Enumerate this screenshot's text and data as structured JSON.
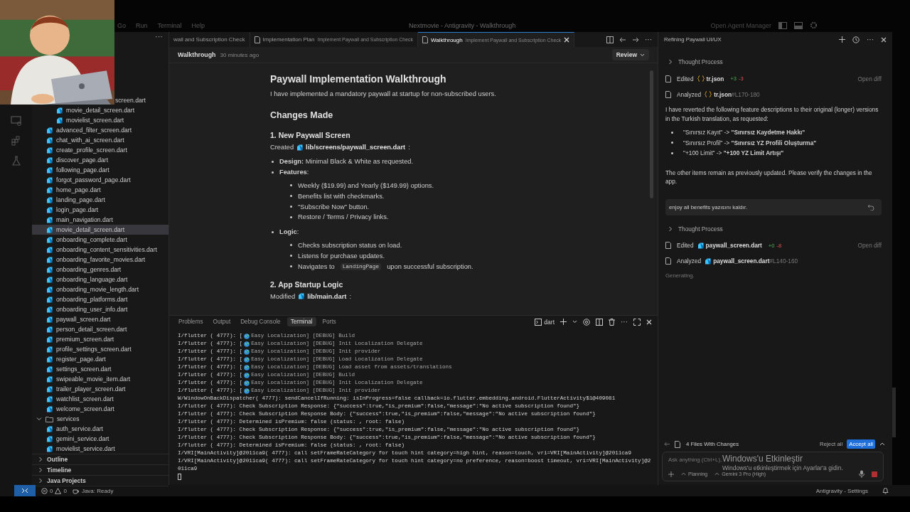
{
  "titlebar": {
    "menu": [
      "Go",
      "Run",
      "Terminal",
      "Help"
    ],
    "title": "Nextmovie - Antigravity - Walkthrough",
    "agent_manager": "Open Agent Manager"
  },
  "explorer": {
    "tree": [
      {
        "children": [
          {
            "children": [
              {
                "kind": "clipped",
                "name": "screen.dart",
                "selected": false
              },
              {
                "kind": "file",
                "name": "movie_detail_screen.dart",
                "selected": false
              },
              {
                "kind": "file",
                "name": "movielist_screen.dart",
                "selected": false
              }
            ]
          },
          {
            "kind": "file",
            "name": "advanced_filter_screen.dart",
            "selected": false
          },
          {
            "kind": "file",
            "name": "chat_with_ai_screen.dart",
            "selected": false
          },
          {
            "kind": "file",
            "name": "create_profile_screen.dart",
            "selected": false
          },
          {
            "kind": "file",
            "name": "discover_page.dart",
            "selected": false
          },
          {
            "kind": "file",
            "name": "following_page.dart",
            "selected": false
          },
          {
            "kind": "file",
            "name": "forgot_password_page.dart",
            "selected": false
          },
          {
            "kind": "file",
            "name": "home_page.dart",
            "selected": false
          },
          {
            "kind": "file",
            "name": "landing_page.dart",
            "selected": false
          },
          {
            "kind": "file",
            "name": "login_page.dart",
            "selected": false
          },
          {
            "kind": "file",
            "name": "main_navigation.dart",
            "selected": false
          },
          {
            "kind": "file",
            "name": "movie_detail_screen.dart",
            "selected": true
          },
          {
            "kind": "file",
            "name": "onboarding_complete.dart",
            "selected": false
          },
          {
            "kind": "file",
            "name": "onboarding_content_sensitivities.dart",
            "selected": false
          },
          {
            "kind": "file",
            "name": "onboarding_favorite_movies.dart",
            "selected": false
          },
          {
            "kind": "file",
            "name": "onboarding_genres.dart",
            "selected": false
          },
          {
            "kind": "file",
            "name": "onboarding_language.dart",
            "selected": false
          },
          {
            "kind": "file",
            "name": "onboarding_movie_length.dart",
            "selected": false
          },
          {
            "kind": "file",
            "name": "onboarding_platforms.dart",
            "selected": false
          },
          {
            "kind": "file",
            "name": "onboarding_user_info.dart",
            "selected": false
          },
          {
            "kind": "file",
            "name": "paywall_screen.dart",
            "selected": false
          },
          {
            "kind": "file",
            "name": "person_detail_screen.dart",
            "selected": false
          },
          {
            "kind": "file",
            "name": "premium_screen.dart",
            "selected": false
          },
          {
            "kind": "file",
            "name": "profile_settings_screen.dart",
            "selected": false
          },
          {
            "kind": "file",
            "name": "register_page.dart",
            "selected": false
          },
          {
            "kind": "file",
            "name": "settings_screen.dart",
            "selected": false
          },
          {
            "kind": "file",
            "name": "swipeable_movie_item.dart",
            "selected": false
          },
          {
            "kind": "file",
            "name": "trailer_player_screen.dart",
            "selected": false
          },
          {
            "kind": "file",
            "name": "watchlist_screen.dart",
            "selected": false
          },
          {
            "kind": "file",
            "name": "welcome_screen.dart",
            "selected": false
          }
        ]
      },
      {
        "kind": "folder",
        "name": "services",
        "expanded": true,
        "children": [
          {
            "kind": "file",
            "name": "auth_service.dart",
            "selected": false
          },
          {
            "kind": "file",
            "name": "gemini_service.dart",
            "selected": false
          },
          {
            "kind": "file",
            "name": "movielist_service.dart",
            "selected": false
          }
        ]
      }
    ],
    "more": "···",
    "sections": [
      {
        "label": "Outline",
        "expanded": false
      },
      {
        "label": "Timeline",
        "expanded": false
      },
      {
        "label": "Java Projects",
        "expanded": false
      }
    ]
  },
  "editor": {
    "tabs": [
      {
        "label": "wall and Subscription Check",
        "selected": false
      },
      {
        "label": "Implementation Plan",
        "description": "Implement Paywall and Subscription Check",
        "selected": false
      },
      {
        "label": "Walkthrough",
        "description": "Implement Paywall and Subscription Check",
        "selected": true
      }
    ],
    "more": "···",
    "breadcrumb": {
      "title": "Walkthrough",
      "time": "30 minutes ago",
      "review": "Review"
    },
    "doc": {
      "title": "Paywall Implementation Walkthrough",
      "intro": "I have implemented a mandatory paywall at startup for non-subscribed users.",
      "blocks": [
        {
          "kind": "h2",
          "text": "Changes Made"
        },
        {
          "kind": "h3",
          "text": "1. New Paywall Screen"
        },
        {
          "kind": "fileref",
          "label": "Created",
          "path": "lib/screens/paywall_screen.dart",
          "after": ":"
        },
        {
          "kind": "list",
          "items": [
            {
              "text": "**Design:** Minimal Black & White as requested."
            },
            {
              "text": "**Features**:",
              "children": [
                {
                  "text": "Weekly ($19.99) and Yearly ($149.99) options."
                },
                {
                  "text": "Benefits list with checkmarks."
                },
                {
                  "text": "\"Subscribe Now\" button."
                },
                {
                  "text": "Restore / Terms / Privacy links."
                }
              ]
            },
            {
              "text": "**Logic**:",
              "children": [
                {
                  "text": "Checks subscription status on load."
                },
                {
                  "text": "Listens for purchase updates."
                },
                {
                  "text": "Navigates to",
                  "code": "LandingPage",
                  "after": "upon successful subscription."
                }
              ]
            }
          ]
        },
        {
          "kind": "h3",
          "text": "2. App Startup Logic"
        },
        {
          "kind": "fileref",
          "label": "Modified",
          "path": "lib/main.dart",
          "after": ":"
        }
      ]
    }
  },
  "panel": {
    "tabs": [
      {
        "label": "Problems",
        "selected": false
      },
      {
        "label": "Output",
        "selected": false
      },
      {
        "label": "Debug Console",
        "selected": false
      },
      {
        "label": "Terminal",
        "selected": true
      },
      {
        "label": "Ports",
        "selected": false
      }
    ],
    "shell": "dart",
    "more": "···",
    "lines": [
      {
        "kind": "easy",
        "prefix": "I/flutter ( 4777): [",
        "text": "Easy Localization] [DEBUG] Build"
      },
      {
        "kind": "easy",
        "prefix": "I/flutter ( 4777): [",
        "text": "Easy Localization] [DEBUG] Init Localization Delegate"
      },
      {
        "kind": "easy",
        "prefix": "I/flutter ( 4777): [",
        "text": "Easy Localization] [DEBUG] Init provider"
      },
      {
        "kind": "easy",
        "prefix": "I/flutter ( 4777): [",
        "text": "Easy Localization] [DEBUG] Load Localization Delegate"
      },
      {
        "kind": "easy",
        "prefix": "I/flutter ( 4777): [",
        "text": "Easy Localization] [DEBUG] Load asset from assets/translations"
      },
      {
        "kind": "easy",
        "prefix": "I/flutter ( 4777): [",
        "text": "Easy Localization] [DEBUG] Build"
      },
      {
        "kind": "easy",
        "prefix": "I/flutter ( 4777): [",
        "text": "Easy Localization] [DEBUG] Init Localization Delegate"
      },
      {
        "kind": "easy",
        "prefix": "I/flutter ( 4777): [",
        "text": "Easy Localization] [DEBUG] Init provider"
      },
      {
        "kind": "plain",
        "text": "W/WindowOnBackDispatcher( 4777): sendCancelIfRunning: isInProgress=false callback=io.flutter.embedding.android.FlutterActivity$1@409081"
      },
      {
        "kind": "plain",
        "text": "I/flutter ( 4777): Check Subscription Response: {\"success\":true,\"is_premium\":false,\"message\":\"No active subscription found\"}"
      },
      {
        "kind": "plain",
        "text": "I/flutter ( 4777): Check Subscription Response Body: {\"success\":true,\"is_premium\":false,\"message\":\"No active subscription found\"}"
      },
      {
        "kind": "plain",
        "text": "I/flutter ( 4777): Determined isPremium: false (status: , root: false)"
      },
      {
        "kind": "plain",
        "text": "I/flutter ( 4777): Check Subscription Response: {\"success\":true,\"is_premium\":false,\"message\":\"No active subscription found\"}"
      },
      {
        "kind": "plain",
        "text": "I/flutter ( 4777): Check Subscription Response Body: {\"success\":true,\"is_premium\":false,\"message\":\"No active subscription found\"}"
      },
      {
        "kind": "plain",
        "text": "I/flutter ( 4777): Determined isPremium: false (status: , root: false)"
      },
      {
        "kind": "plain",
        "text": "I/VRI[MainActivity]@2011ca9( 4777): call setFrameRateCategory for touch hint category=high hint, reason=touch, vri=VRI[MainActivity]@2011ca9"
      },
      {
        "kind": "plain",
        "text": "I/VRI[MainActivity]@2011ca9( 4777): call setFrameRateCategory for touch hint category=no preference, reason=boost timeout, vri=VRI[MainActivity]@2"
      },
      {
        "kind": "plain",
        "text": "011ca9"
      },
      {
        "kind": "cursor"
      }
    ]
  },
  "chat": {
    "title": "Refining Paywall UI/UX",
    "more": "···",
    "blocks": [
      {
        "kind": "thought",
        "text": "Thought Process"
      },
      {
        "kind": "json-action",
        "verb": "Edited",
        "file": "tr.json",
        "added": "+3",
        "removed": "-3",
        "link": "Open diff"
      },
      {
        "kind": "json-action",
        "verb": "Analyzed",
        "file": "tr.json",
        "range": "#L170-180"
      },
      {
        "kind": "para",
        "text": "I have reverted the following feature descriptions to their original (longer) versions in the Turkish translation, as requested:"
      },
      {
        "kind": "bullets",
        "items": [
          "\"Sınırsız Kayıt\" -> **\"Sınırsız Kaydetme Hakkı\"**",
          "\"Sınırsız Profil\" -> **\"Sınırsız YZ Profili Oluşturma\"**",
          "\"+100 Limit\" -> **\"+100 YZ Limit Artışı\"**"
        ]
      },
      {
        "kind": "para",
        "text": "The other items remain as previously updated. Please verify the changes in the app."
      },
      {
        "kind": "user",
        "text": "enjoy all benefits yazısını kaldır."
      },
      {
        "kind": "thought",
        "text": "Thought Process"
      },
      {
        "kind": "dart-action",
        "verb": "Edited",
        "file": "paywall_screen.dart",
        "added": "+0",
        "removed": "-8",
        "link": "Open diff"
      },
      {
        "kind": "dart-action",
        "verb": "Analyzed",
        "file": "paywall_screen.dart",
        "range": "#L140-160"
      },
      {
        "kind": "status",
        "text": "Generating."
      }
    ],
    "changes": {
      "label": "4 Files With Changes",
      "reject": "Reject all",
      "accept": "Accept all"
    },
    "input": {
      "placeholder": "Ask anything (Ctrl+L),",
      "mode": "Planning",
      "model": "Gemini 3 Pro (High)"
    },
    "activation": {
      "title": "Windows'u Etkinleştir",
      "note": "Windows'u etkinleştirmek için Ayarlar'a gidin."
    }
  },
  "status_bar": {
    "errors": "0",
    "warnings": "0",
    "java": "Java: Ready",
    "right": "Antigravity - Settings"
  }
}
